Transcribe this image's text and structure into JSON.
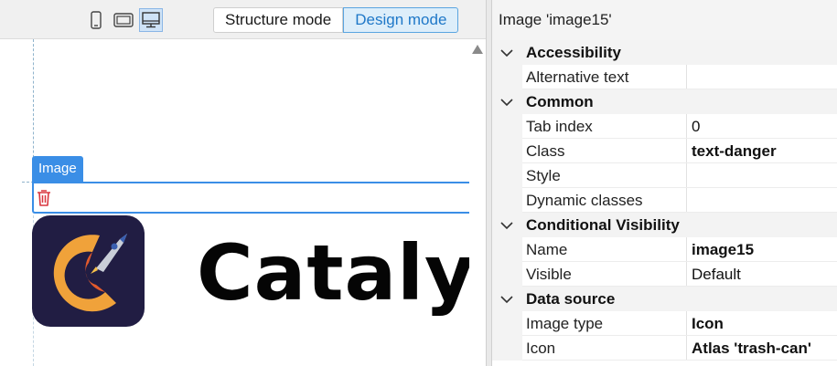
{
  "toolbar": {
    "devices": [
      {
        "icon": "phone-icon",
        "active": false
      },
      {
        "icon": "tablet-icon",
        "active": false
      },
      {
        "icon": "desktop-icon",
        "active": true
      }
    ],
    "structure_mode_label": "Structure mode",
    "design_mode_label": "Design mode",
    "active_mode": "Design mode"
  },
  "canvas": {
    "selected_widget_label": "Image",
    "selected_icon": "trash-can-icon",
    "brand_text": "Catalys",
    "accent_color": "#3a8ee6",
    "danger_color": "#d9363e"
  },
  "properties": {
    "title": "Image 'image15'",
    "categories": [
      {
        "label": "Accessibility",
        "rows": [
          {
            "name": "Alternative text",
            "value": "",
            "bold": false
          }
        ]
      },
      {
        "label": "Common",
        "rows": [
          {
            "name": "Tab index",
            "value": "0",
            "bold": false
          },
          {
            "name": "Class",
            "value": "text-danger",
            "bold": true
          },
          {
            "name": "Style",
            "value": "",
            "bold": false
          },
          {
            "name": "Dynamic classes",
            "value": "",
            "bold": false
          }
        ]
      },
      {
        "label": "Conditional Visibility",
        "rows": [
          {
            "name": "Name",
            "value": "image15",
            "bold": true
          },
          {
            "name": "Visible",
            "value": "Default",
            "bold": false
          }
        ]
      },
      {
        "label": "Data source",
        "rows": [
          {
            "name": "Image type",
            "value": "Icon",
            "bold": true
          },
          {
            "name": "Icon",
            "value": "Atlas 'trash-can'",
            "bold": true
          }
        ]
      }
    ]
  }
}
